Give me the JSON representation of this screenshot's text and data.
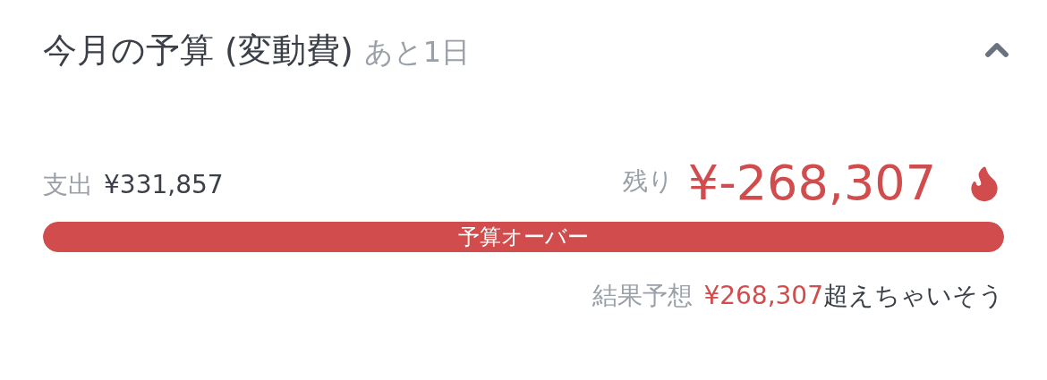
{
  "header": {
    "title": "今月の予算 (変動費)",
    "days_left": "あと1日",
    "expanded": true
  },
  "spent": {
    "label": "支出",
    "amount": "¥331,857"
  },
  "remaining": {
    "label": "残り",
    "amount": "¥-268,307",
    "over": true
  },
  "progress": {
    "level": 1,
    "label": "予算オーバー"
  },
  "forecast": {
    "label": "結果予想",
    "amount": "¥268,307",
    "suffix": "超えちゃいそう"
  }
}
